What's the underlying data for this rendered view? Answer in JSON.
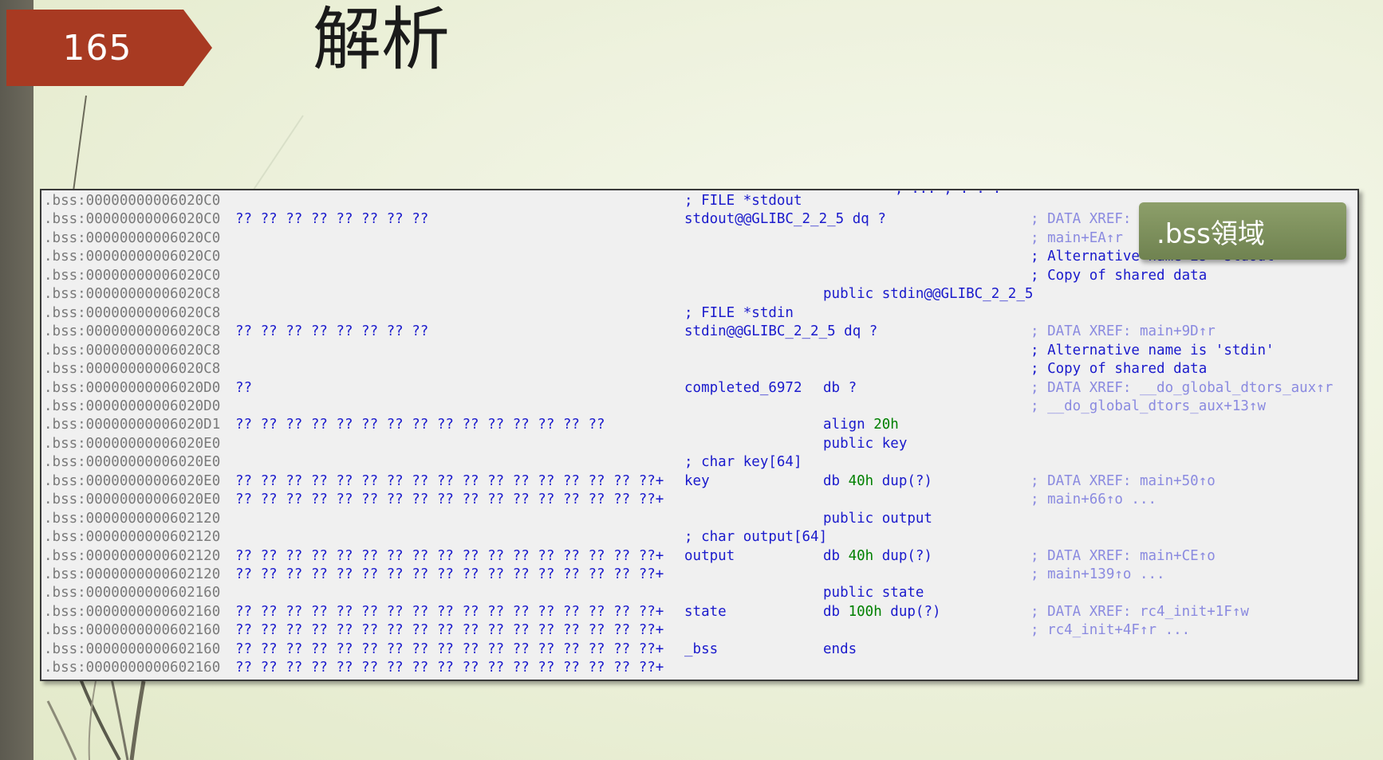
{
  "slide": {
    "page_number": "165",
    "title": "解析",
    "callout": ".bss領域"
  },
  "disasm": {
    "cutoff_text": "; ... ; . . .",
    "rows": [
      {
        "addr": ".bss:00000000006020C0",
        "bytes": "",
        "label": "",
        "instr": "",
        "comment_mid": "; FILE *stdout",
        "public": "",
        "xref": "",
        "note": ""
      },
      {
        "addr": ".bss:00000000006020C0",
        "bytes": "?? ?? ?? ?? ?? ?? ?? ??",
        "label": "stdout@@GLIBC_2_2_5 dq ?",
        "instr": "",
        "comment_mid": "",
        "public": "",
        "xref": "; DATA XREF: ",
        "note": ""
      },
      {
        "addr": ".bss:00000000006020C0",
        "bytes": "",
        "label": "",
        "instr": "",
        "comment_mid": "",
        "public": "",
        "xref": "; main+EA↑r",
        "note": ""
      },
      {
        "addr": ".bss:00000000006020C0",
        "bytes": "",
        "label": "",
        "instr": "",
        "comment_mid": "",
        "public": "",
        "xref": "",
        "note": "; Alternative name is 'stdout'"
      },
      {
        "addr": ".bss:00000000006020C0",
        "bytes": "",
        "label": "",
        "instr": "",
        "comment_mid": "",
        "public": "",
        "xref": "",
        "note": "; Copy of shared data"
      },
      {
        "addr": ".bss:00000000006020C8",
        "bytes": "",
        "label": "",
        "instr": "",
        "comment_mid": "",
        "public": "public stdin@@GLIBC_2_2_5",
        "xref": "",
        "note": ""
      },
      {
        "addr": ".bss:00000000006020C8",
        "bytes": "",
        "label": "",
        "instr": "",
        "comment_mid": "; FILE *stdin",
        "public": "",
        "xref": "",
        "note": ""
      },
      {
        "addr": ".bss:00000000006020C8",
        "bytes": "?? ?? ?? ?? ?? ?? ?? ??",
        "label": "stdin@@GLIBC_2_2_5 dq ?",
        "instr": "",
        "comment_mid": "",
        "public": "",
        "xref": "; DATA XREF: main+9D↑r",
        "note": ""
      },
      {
        "addr": ".bss:00000000006020C8",
        "bytes": "",
        "label": "",
        "instr": "",
        "comment_mid": "",
        "public": "",
        "xref": "",
        "note": "; Alternative name is 'stdin'"
      },
      {
        "addr": ".bss:00000000006020C8",
        "bytes": "",
        "label": "",
        "instr": "",
        "comment_mid": "",
        "public": "",
        "xref": "",
        "note": "; Copy of shared data"
      },
      {
        "addr": ".bss:00000000006020D0",
        "bytes": "??",
        "label": "completed_6972",
        "instr": "db ?",
        "comment_mid": "",
        "public": "",
        "xref": "; DATA XREF: __do_global_dtors_aux↑r",
        "note": ""
      },
      {
        "addr": ".bss:00000000006020D0",
        "bytes": "",
        "label": "",
        "instr": "",
        "comment_mid": "",
        "public": "",
        "xref": "; __do_global_dtors_aux+13↑w",
        "note": ""
      },
      {
        "addr": ".bss:00000000006020D1",
        "bytes": "?? ?? ?? ?? ?? ?? ?? ?? ?? ?? ?? ?? ?? ?? ??",
        "label": "",
        "instr": "align 20h",
        "comment_mid": "",
        "public": "",
        "xref": "",
        "note": ""
      },
      {
        "addr": ".bss:00000000006020E0",
        "bytes": "",
        "label": "",
        "instr": "",
        "comment_mid": "",
        "public": "public key",
        "xref": "",
        "note": ""
      },
      {
        "addr": ".bss:00000000006020E0",
        "bytes": "",
        "label": "",
        "instr": "",
        "comment_mid": "; char key[64]",
        "public": "",
        "xref": "",
        "note": ""
      },
      {
        "addr": ".bss:00000000006020E0",
        "bytes": "?? ?? ?? ?? ?? ?? ?? ?? ?? ?? ?? ?? ?? ?? ?? ?? ??+",
        "label": "key",
        "instr": "db 40h dup(?)",
        "comment_mid": "",
        "public": "",
        "xref": "; DATA XREF: main+50↑o",
        "note": ""
      },
      {
        "addr": ".bss:00000000006020E0",
        "bytes": "?? ?? ?? ?? ?? ?? ?? ?? ?? ?? ?? ?? ?? ?? ?? ?? ??+",
        "label": "",
        "instr": "",
        "comment_mid": "",
        "public": "",
        "xref": "; main+66↑o ...",
        "note": ""
      },
      {
        "addr": ".bss:0000000000602120",
        "bytes": "",
        "label": "",
        "instr": "",
        "comment_mid": "",
        "public": "public output",
        "xref": "",
        "note": ""
      },
      {
        "addr": ".bss:0000000000602120",
        "bytes": "",
        "label": "",
        "instr": "",
        "comment_mid": "; char output[64]",
        "public": "",
        "xref": "",
        "note": ""
      },
      {
        "addr": ".bss:0000000000602120",
        "bytes": "?? ?? ?? ?? ?? ?? ?? ?? ?? ?? ?? ?? ?? ?? ?? ?? ??+",
        "label": "output",
        "instr": "db 40h dup(?)",
        "comment_mid": "",
        "public": "",
        "xref": "; DATA XREF: main+CE↑o",
        "note": ""
      },
      {
        "addr": ".bss:0000000000602120",
        "bytes": "?? ?? ?? ?? ?? ?? ?? ?? ?? ?? ?? ?? ?? ?? ?? ?? ??+",
        "label": "",
        "instr": "",
        "comment_mid": "",
        "public": "",
        "xref": "; main+139↑o ...",
        "note": ""
      },
      {
        "addr": ".bss:0000000000602160",
        "bytes": "",
        "label": "",
        "instr": "",
        "comment_mid": "",
        "public": "public state",
        "xref": "",
        "note": ""
      },
      {
        "addr": ".bss:0000000000602160",
        "bytes": "?? ?? ?? ?? ?? ?? ?? ?? ?? ?? ?? ?? ?? ?? ?? ?? ??+",
        "label": "state",
        "instr": "db 100h dup(?)",
        "comment_mid": "",
        "public": "",
        "xref": "; DATA XREF: rc4_init+1F↑w",
        "note": ""
      },
      {
        "addr": ".bss:0000000000602160",
        "bytes": "?? ?? ?? ?? ?? ?? ?? ?? ?? ?? ?? ?? ?? ?? ?? ?? ??+",
        "label": "",
        "instr": "",
        "comment_mid": "",
        "public": "",
        "xref": "; rc4_init+4F↑r ...",
        "note": ""
      },
      {
        "addr": ".bss:0000000000602160",
        "bytes": "?? ?? ?? ?? ?? ?? ?? ?? ?? ?? ?? ?? ?? ?? ?? ?? ??+",
        "label": "_bss",
        "instr": "ends",
        "comment_mid": "",
        "public": "",
        "xref": "",
        "note": ""
      },
      {
        "addr": ".bss:0000000000602160",
        "bytes": "?? ?? ?? ?? ?? ?? ?? ?? ?? ?? ?? ?? ?? ?? ?? ?? ??+",
        "label": "",
        "instr": "",
        "comment_mid": "",
        "public": "",
        "xref": "",
        "note": ""
      }
    ]
  },
  "colors": {
    "badge": "#a83a22",
    "callout": "#7c8e5c",
    "code_blue": "#1a1acc",
    "address_gray": "#7a7a7a",
    "hex_green": "#008000",
    "xref_lightblue": "#8a8ae0"
  }
}
